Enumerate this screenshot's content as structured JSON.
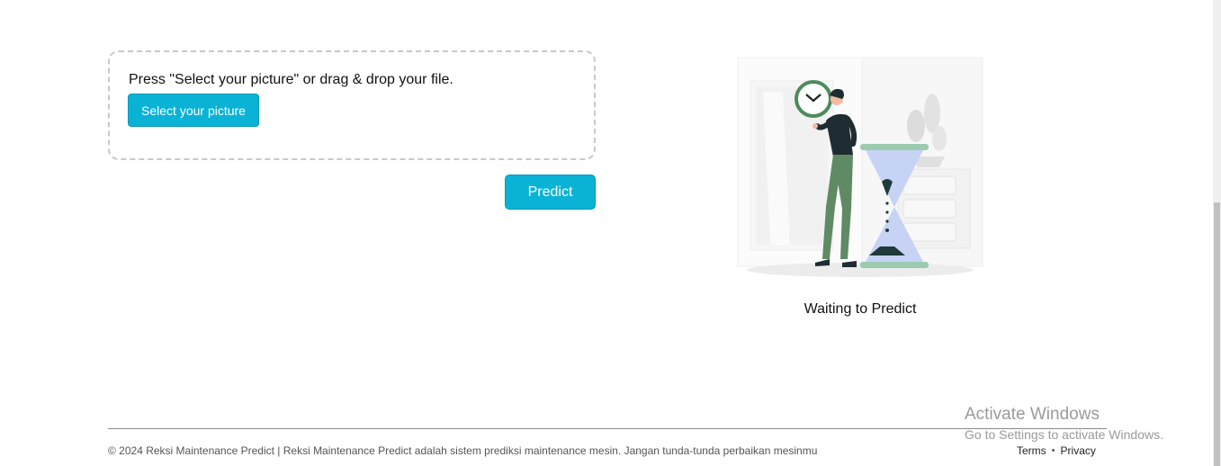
{
  "upload": {
    "instruction": "Press \"Select your picture\" or drag & drop your file.",
    "select_button_label": "Select your picture"
  },
  "actions": {
    "predict_button_label": "Predict"
  },
  "result": {
    "illustration_icon": "waiting-hourglass-person-illustration",
    "status_text": "Waiting to Predict"
  },
  "footer": {
    "copyright": "© 2024 Reksi Maintenance Predict | Reksi Maintenance Predict adalah sistem prediksi maintenance mesin. Jangan tunda-tunda perbaikan mesinmu",
    "links": {
      "terms": "Terms",
      "separator": "•",
      "privacy": "Privacy"
    }
  },
  "watermark": {
    "title": "Activate Windows",
    "subtitle": "Go to Settings to activate Windows."
  },
  "colors": {
    "accent": "#0ab3d6",
    "clock_green": "#4e8a5b",
    "hourglass_blue": "#c7d3f5",
    "pants_green": "#5f8a64"
  }
}
